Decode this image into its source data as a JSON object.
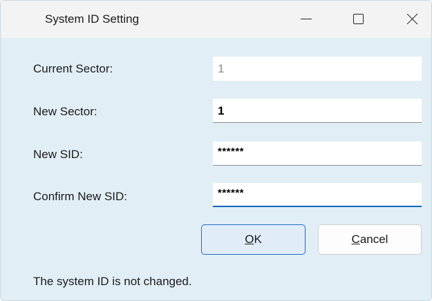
{
  "window": {
    "title": "System ID Setting"
  },
  "titlebar_icons": {
    "minimize": "minimize-icon",
    "maximize": "maximize-icon",
    "close": "close-icon"
  },
  "form": {
    "current_sector": {
      "label": "Current Sector:",
      "value": "1"
    },
    "new_sector": {
      "label": "New Sector:",
      "value": "1"
    },
    "new_sid": {
      "label": "New SID:",
      "value": "******"
    },
    "confirm_sid": {
      "label": "Confirm New SID:",
      "value": "******"
    }
  },
  "buttons": {
    "ok": {
      "mnemonic": "O",
      "rest": "K"
    },
    "cancel": {
      "mnemonic": "C",
      "rest": "ancel"
    }
  },
  "status": "The system ID is not changed.",
  "colors": {
    "dialog_background": "#e2eef6",
    "focus_accent": "#0067c0"
  }
}
